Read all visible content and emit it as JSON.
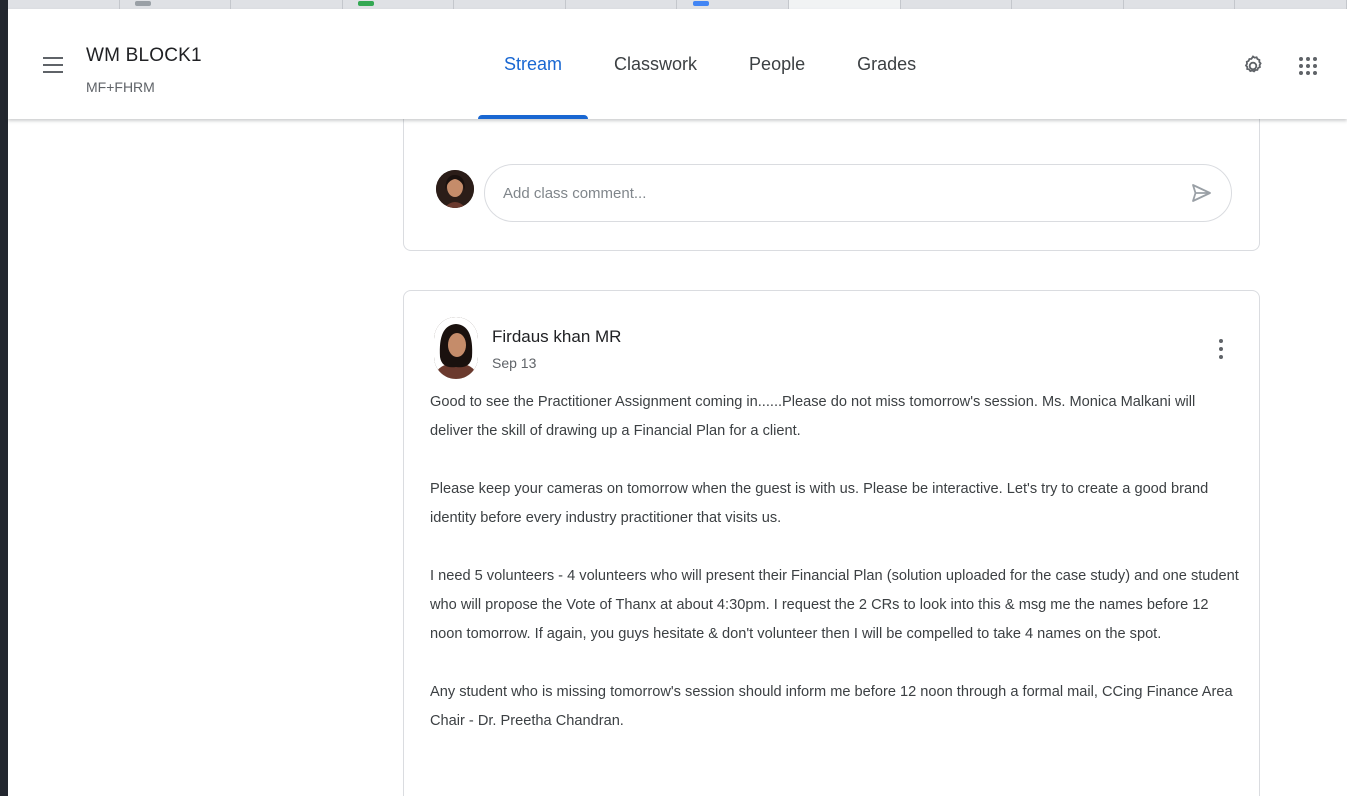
{
  "header": {
    "class_title": "WM BLOCK1",
    "class_subtitle": "MF+FHRM",
    "tabs": [
      {
        "label": "Stream",
        "active": true
      },
      {
        "label": "Classwork",
        "active": false
      },
      {
        "label": "People",
        "active": false
      },
      {
        "label": "Grades",
        "active": false
      }
    ],
    "icons": {
      "menu": "menu-icon",
      "settings": "gear-icon",
      "apps": "apps-grid-icon"
    }
  },
  "comment": {
    "placeholder": "Add class comment...",
    "send_icon": "send-icon"
  },
  "post": {
    "author": "Firdaus khan MR",
    "date": "Sep 13",
    "paragraphs": [
      "Good to see the Practitioner Assignment coming in......Please do not miss tomorrow's session. Ms. Monica Malkani will deliver the skill of drawing up a Financial Plan for a client.",
      "Please keep your cameras on tomorrow when the guest is with us. Please be interactive. Let's try to create a good brand identity before every industry practitioner that visits us.",
      "I need 5 volunteers - 4 volunteers who will present their Financial Plan (solution uploaded for the case study) and one student who will propose the Vote of Thanx at about 4:30pm. I request the 2 CRs to look into this & msg me the names before 12 noon tomorrow. If again, you guys hesitate & don't volunteer then I will be compelled to take 4 names on the spot.",
      "Any student who is missing tomorrow's session should inform me before 12 noon through a formal mail, CCing Finance Area Chair - Dr. Preetha Chandran."
    ],
    "more_icon": "more-vert-icon"
  },
  "colors": {
    "accent": "#1967d2",
    "border": "#dadce0",
    "text": "#3c4043"
  }
}
